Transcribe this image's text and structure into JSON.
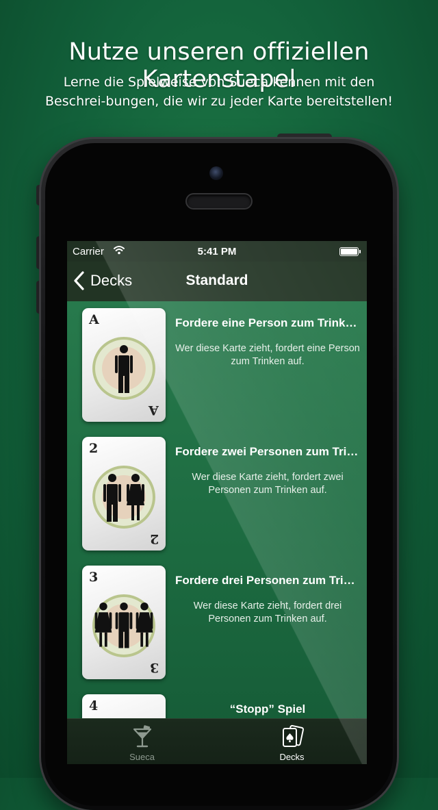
{
  "headline": "Nutze unseren offiziellen Kartenstapel",
  "subline": "Lerne die Spielweise von Sueca kennen mit den Beschrei-bungen, die wir zu jeder Karte bereitstellen!",
  "status_bar": {
    "carrier": "Carrier",
    "time": "5:41 PM"
  },
  "nav": {
    "back_label": "Decks",
    "title": "Standard"
  },
  "cards": [
    {
      "rank": "A",
      "title": "Fordere eine Person zum Trinken auf",
      "description": "Wer diese Karte zieht, fordert eine Person zum Trinken auf.",
      "figures": [
        "man"
      ]
    },
    {
      "rank": "2",
      "title": "Fordere zwei Personen zum Trinken auf",
      "description": "Wer diese Karte zieht, fordert zwei Personen zum Trinken auf.",
      "figures": [
        "man",
        "woman"
      ]
    },
    {
      "rank": "3",
      "title": "Fordere drei Personen zum Trinken auf",
      "description": "Wer diese Karte zieht, fordert drei Personen zum Trinken auf.",
      "figures": [
        "woman",
        "man",
        "woman"
      ]
    },
    {
      "rank": "4",
      "title": "“Stopp” Spiel",
      "description": "",
      "figures": []
    }
  ],
  "tabs": [
    {
      "label": "Sueca",
      "icon": "cocktail-glass-icon",
      "color": "#8e9a90"
    },
    {
      "label": "Decks",
      "icon": "playing-cards-icon",
      "color": "#ffffff"
    }
  ],
  "colors": {
    "background": "#12603a",
    "screen": "#1c6a40",
    "bar": "#223424"
  }
}
